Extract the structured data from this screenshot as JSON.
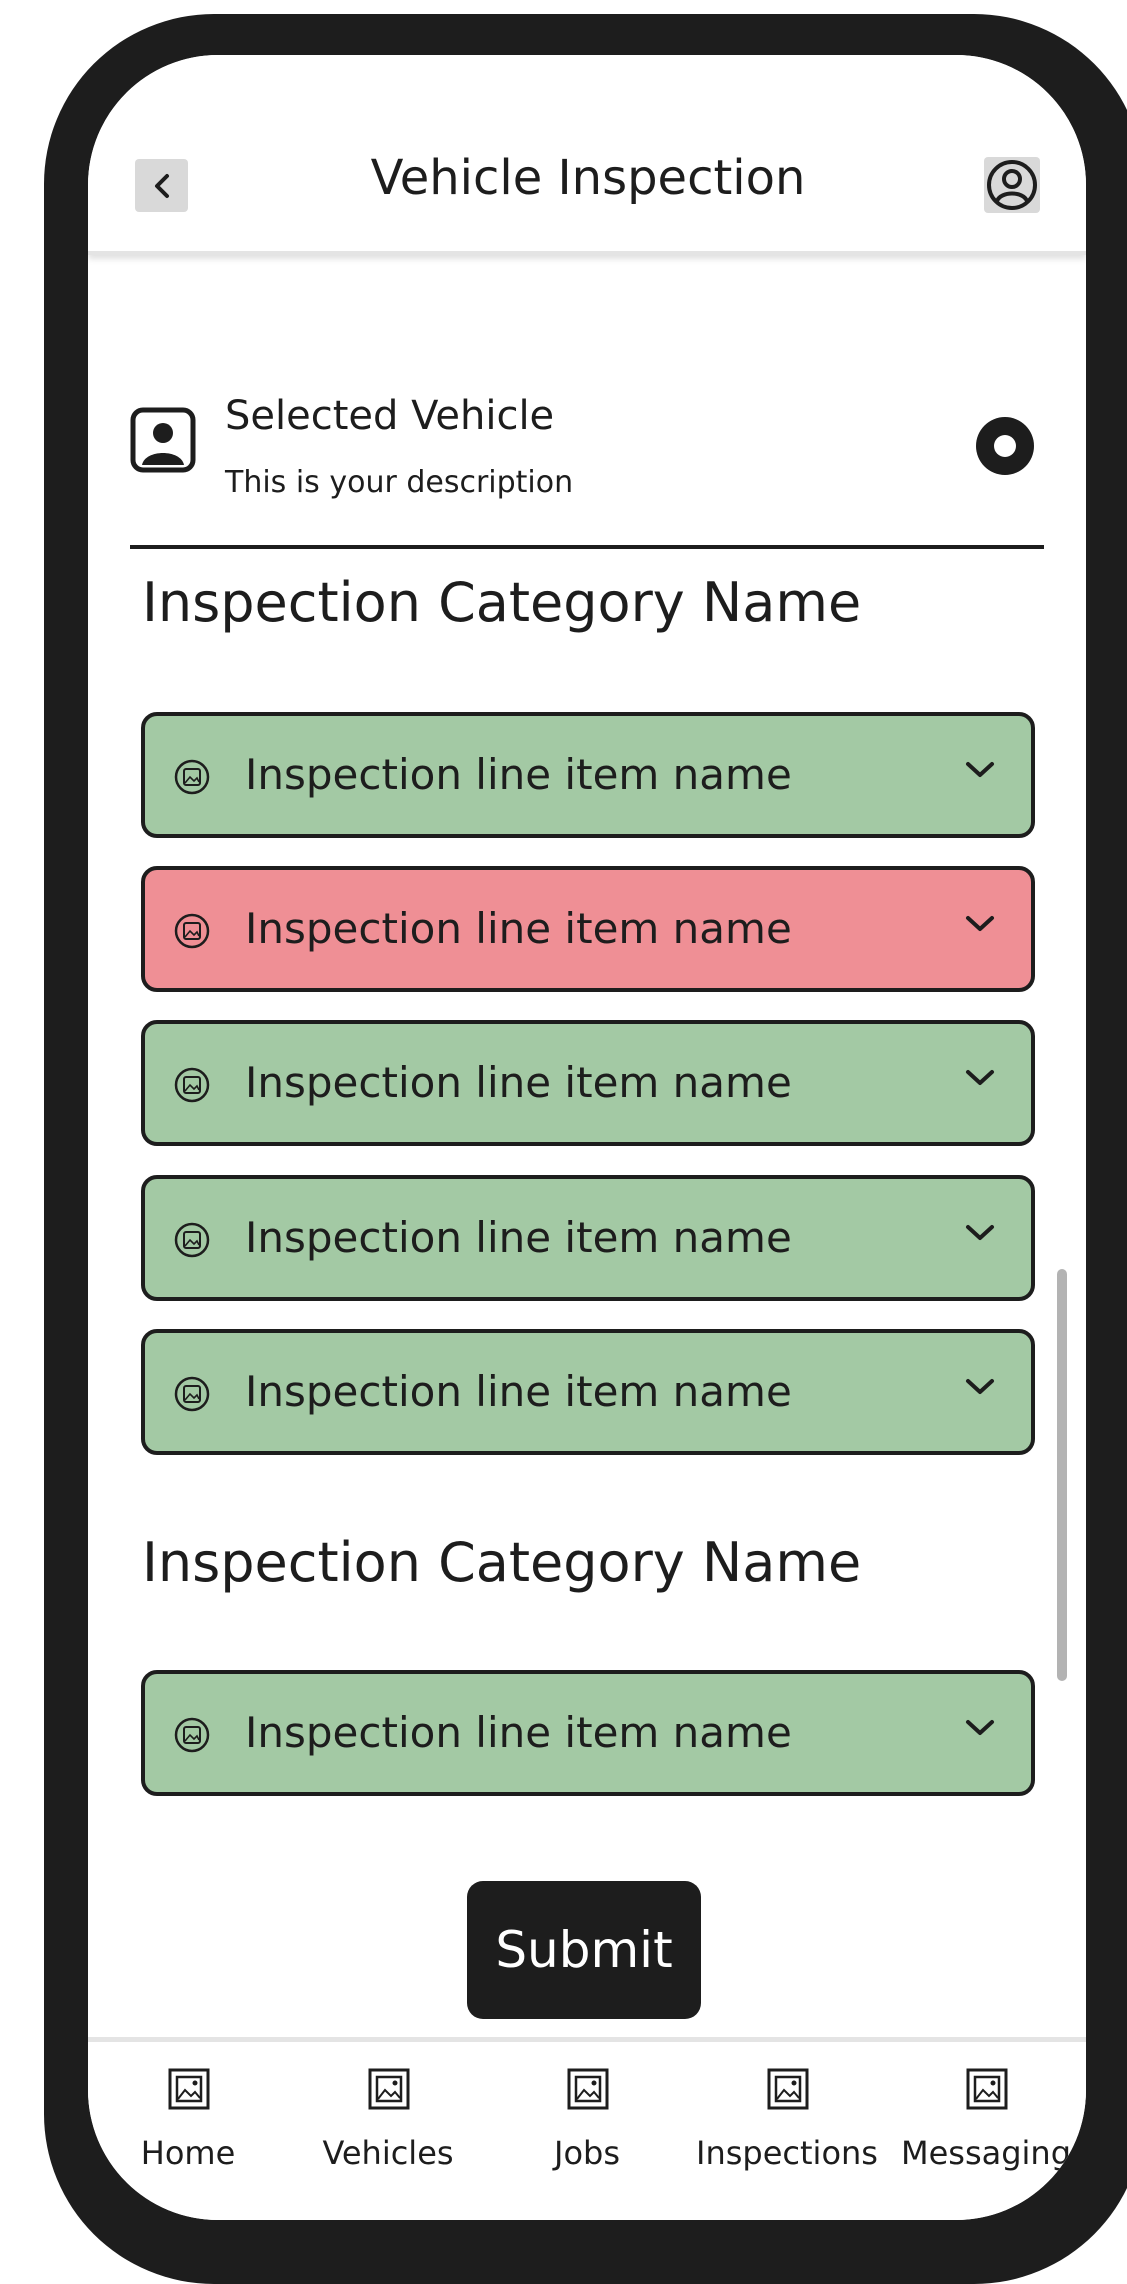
{
  "header": {
    "title": "Vehicle Inspection",
    "back_icon": "chevron-left-icon",
    "profile_icon": "user-circle-icon"
  },
  "vehicle": {
    "title": "Selected Vehicle",
    "description": "This is your description",
    "avatar_icon": "user-square-icon",
    "radio_selected": true
  },
  "categories": [
    {
      "name": "Inspection Category Name",
      "items": [
        {
          "label": "Inspection line item name",
          "status": "pass",
          "color": "#a3c9a4"
        },
        {
          "label": "Inspection line item name",
          "status": "fail",
          "color": "#ef8f95"
        },
        {
          "label": "Inspection line item name",
          "status": "pass",
          "color": "#a3c9a4"
        },
        {
          "label": "Inspection line item name",
          "status": "pass",
          "color": "#a3c9a4"
        },
        {
          "label": "Inspection line item name",
          "status": "pass",
          "color": "#a3c9a4"
        }
      ]
    },
    {
      "name": "Inspection Category Name",
      "items": [
        {
          "label": "Inspection line item name",
          "status": "pass",
          "color": "#a3c9a4"
        }
      ]
    }
  ],
  "submit_label": "Submit",
  "nav": {
    "items": [
      {
        "label": "Home",
        "icon": "image-icon"
      },
      {
        "label": "Vehicles",
        "icon": "image-icon"
      },
      {
        "label": "Jobs",
        "icon": "image-icon"
      },
      {
        "label": "Inspections",
        "icon": "image-icon"
      },
      {
        "label": "Messaging",
        "icon": "image-icon"
      }
    ]
  },
  "colors": {
    "frame": "#1d1d1d",
    "pass": "#a3c9a4",
    "fail": "#ef8f95",
    "button_gray": "#d9d9d9"
  }
}
